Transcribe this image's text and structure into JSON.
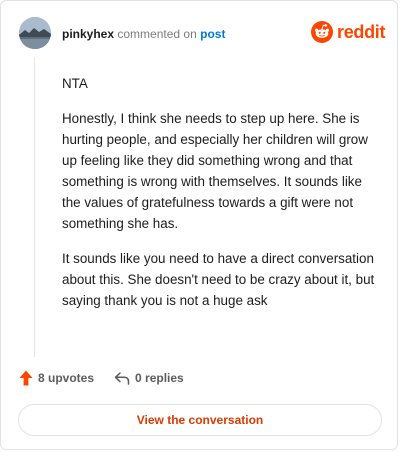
{
  "header": {
    "username": "pinkyhex",
    "action_text": "commented on",
    "post_link": "post"
  },
  "logo": {
    "wordmark": "reddit",
    "icon": "reddit-snoo-icon",
    "brand_color": "#ff4500"
  },
  "comment": {
    "paragraphs": [
      "NTA",
      "Honestly, I think she needs to step up here. She is hurting people, and especially her children will grow up feeling like they did something wrong and that something is wrong with themselves. It sounds like the values of gratefulness towards a gift were not something she has.",
      "It sounds like you need to have a direct conversation about this. She doesn't need to be crazy about it, but saying thank you is not a huge ask"
    ]
  },
  "actions": {
    "upvotes_label": "8 upvotes",
    "upvote_icon": "upvote-arrow-icon",
    "replies_label": "0 replies",
    "reply_icon": "reply-arrow-icon",
    "upvote_color": "#ff4500"
  },
  "cta": {
    "label": "View the conversation",
    "color": "#d93a00"
  }
}
